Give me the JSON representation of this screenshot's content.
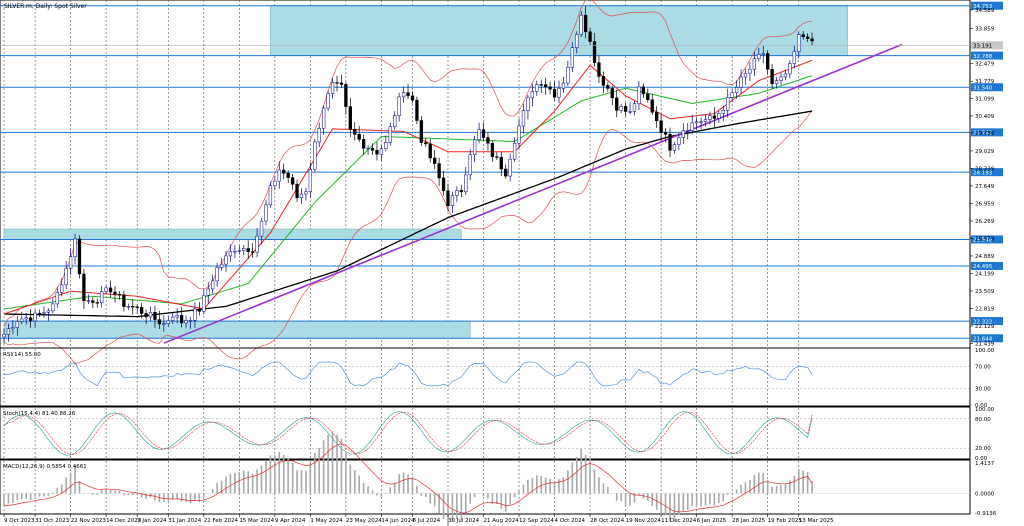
{
  "title": "SILVER.m, Daily: Spot Silver",
  "colors": {
    "bull": "#000080",
    "bear": "#000000",
    "zone": "#a9dce3",
    "hline": "#1e78d2",
    "trend": "#9b30d0",
    "ema20": "#e8231f",
    "ema50": "#22b922",
    "ema200": "#000000",
    "bands": "#e05050",
    "rsi": "#3c7fd8",
    "stoch_main": "#20a0a0",
    "stoch_signal": "#e03030",
    "macd_hist": "#a8a8a8",
    "macd_signal": "#e03030"
  },
  "price_axis": {
    "ticks": [
      "34.589",
      "33.859",
      "33.129",
      "32.479",
      "31.779",
      "31.099",
      "30.409",
      "29.739",
      "29.029",
      "28.339",
      "27.649",
      "26.959",
      "26.269",
      "25.579",
      "24.889",
      "24.199",
      "23.509",
      "22.819",
      "22.129",
      "21.439"
    ],
    "current": "33.191",
    "range": [
      21.3,
      34.9
    ]
  },
  "levels": [
    {
      "price": 34.753,
      "label": "34.753"
    },
    {
      "price": 32.788,
      "label": "32.788"
    },
    {
      "price": 31.54,
      "label": "31.540"
    },
    {
      "price": 29.762,
      "label": "29.762"
    },
    {
      "price": 28.193,
      "label": "28.193"
    },
    {
      "price": 25.54,
      "label": "25.540"
    },
    {
      "price": 24.495,
      "label": "24.495"
    },
    {
      "price": 22.322,
      "label": "22.322"
    },
    {
      "price": 21.644,
      "label": "21.644"
    }
  ],
  "zones": [
    {
      "from_index": 60,
      "to_index": 190,
      "high": 34.753,
      "low": 32.788
    },
    {
      "from_index": 0,
      "to_index": 103,
      "high": 25.95,
      "low": 25.54
    },
    {
      "from_index": 0,
      "to_index": 105,
      "high": 22.322,
      "low": 21.644
    }
  ],
  "trendline": {
    "from_index": 36,
    "from_price": 21.45,
    "to_index": 182,
    "to_price": 31.79
  },
  "x_axis": {
    "labels": [
      {
        "index": 0,
        "text": "9 Oct 2023"
      },
      {
        "index": 7,
        "text": "31 Oct 2023"
      },
      {
        "index": 15,
        "text": "22 Nov 2023"
      },
      {
        "index": 23,
        "text": "14 Dec 2023"
      },
      {
        "index": 30,
        "text": "9 Jan 2024"
      },
      {
        "index": 37,
        "text": "31 Jan 2024"
      },
      {
        "index": 45,
        "text": "22 Feb 2024"
      },
      {
        "index": 53,
        "text": "15 Mar 2024"
      },
      {
        "index": 61,
        "text": "9 Apr 2024"
      },
      {
        "index": 69,
        "text": "1 May 2024"
      },
      {
        "index": 77,
        "text": "23 May 2024"
      },
      {
        "index": 85,
        "text": "14 Jun 2024"
      },
      {
        "index": 92,
        "text": "8 Jul 2024"
      },
      {
        "index": 100,
        "text": "30 Jul 2024"
      },
      {
        "index": 108,
        "text": "21 Aug 2024"
      },
      {
        "index": 116,
        "text": "12 Sep 2024"
      },
      {
        "index": 124,
        "text": "4 Oct 2024"
      },
      {
        "index": 132,
        "text": "28 Oct 2024"
      },
      {
        "index": 140,
        "text": "19 Nov 2024"
      },
      {
        "index": 148,
        "text": "11 Dec 2024"
      },
      {
        "index": 156,
        "text": "6 Jan 2025"
      },
      {
        "index": 164,
        "text": "28 Jan 2025"
      },
      {
        "index": 172,
        "text": "19 Feb 2025"
      },
      {
        "index": 179,
        "text": "13 Mar 2025"
      }
    ]
  },
  "chart_data": {
    "type": "line",
    "description": "Daily silver price path (closing levels estimated from the candlestick chart), one point per bar.",
    "anchors": [
      [
        0,
        21.8
      ],
      [
        3,
        22.4
      ],
      [
        7,
        22.5
      ],
      [
        11,
        22.9
      ],
      [
        14,
        24.4
      ],
      [
        16,
        25.5
      ],
      [
        18,
        23.1
      ],
      [
        21,
        23.2
      ],
      [
        24,
        23.6
      ],
      [
        27,
        23.0
      ],
      [
        30,
        22.8
      ],
      [
        33,
        22.5
      ],
      [
        36,
        22.2
      ],
      [
        38,
        22.6
      ],
      [
        40,
        22.3
      ],
      [
        42,
        22.5
      ],
      [
        44,
        22.8
      ],
      [
        48,
        24.4
      ],
      [
        52,
        25.2
      ],
      [
        56,
        25.2
      ],
      [
        58,
        26.2
      ],
      [
        60,
        27.5
      ],
      [
        62,
        28.3
      ],
      [
        64,
        28.0
      ],
      [
        66,
        27.2
      ],
      [
        68,
        27.5
      ],
      [
        70,
        29.3
      ],
      [
        72,
        30.8
      ],
      [
        74,
        31.6
      ],
      [
        76,
        31.5
      ],
      [
        78,
        29.8
      ],
      [
        81,
        29.3
      ],
      [
        84,
        29.0
      ],
      [
        86,
        29.3
      ],
      [
        88,
        30.5
      ],
      [
        90,
        31.5
      ],
      [
        92,
        31.0
      ],
      [
        94,
        29.5
      ],
      [
        97,
        28.4
      ],
      [
        100,
        27.0
      ],
      [
        103,
        27.5
      ],
      [
        105,
        29.0
      ],
      [
        107,
        29.8
      ],
      [
        110,
        28.9
      ],
      [
        113,
        28.2
      ],
      [
        115,
        29.5
      ],
      [
        117,
        30.5
      ],
      [
        119,
        31.5
      ],
      [
        121,
        31.8
      ],
      [
        124,
        31.3
      ],
      [
        126,
        31.8
      ],
      [
        128,
        33.0
      ],
      [
        130,
        34.5
      ],
      [
        132,
        33.3
      ],
      [
        134,
        32.0
      ],
      [
        136,
        31.5
      ],
      [
        138,
        30.8
      ],
      [
        141,
        30.5
      ],
      [
        143,
        31.4
      ],
      [
        145,
        31.0
      ],
      [
        148,
        29.9
      ],
      [
        150,
        29.2
      ],
      [
        153,
        29.9
      ],
      [
        156,
        30.2
      ],
      [
        160,
        30.3
      ],
      [
        163,
        31.0
      ],
      [
        166,
        31.8
      ],
      [
        169,
        32.5
      ],
      [
        171,
        32.9
      ],
      [
        173,
        31.6
      ],
      [
        175,
        31.8
      ],
      [
        177,
        32.3
      ],
      [
        179,
        33.5
      ],
      [
        181,
        33.6
      ],
      [
        182,
        33.2
      ]
    ],
    "ema20_anchors": [
      [
        0,
        22.6
      ],
      [
        15,
        23.5
      ],
      [
        30,
        23.3
      ],
      [
        45,
        22.8
      ],
      [
        60,
        25.8
      ],
      [
        74,
        29.9
      ],
      [
        90,
        29.8
      ],
      [
        100,
        29.0
      ],
      [
        115,
        29.0
      ],
      [
        124,
        30.6
      ],
      [
        132,
        32.4
      ],
      [
        140,
        31.2
      ],
      [
        150,
        30.3
      ],
      [
        160,
        30.5
      ],
      [
        170,
        31.8
      ],
      [
        182,
        32.6
      ]
    ],
    "ema50_anchors": [
      [
        0,
        22.8
      ],
      [
        20,
        23.3
      ],
      [
        40,
        23.0
      ],
      [
        55,
        23.8
      ],
      [
        70,
        27.0
      ],
      [
        85,
        29.6
      ],
      [
        100,
        29.5
      ],
      [
        115,
        29.4
      ],
      [
        130,
        31.0
      ],
      [
        140,
        31.5
      ],
      [
        155,
        30.9
      ],
      [
        170,
        31.3
      ],
      [
        182,
        32.0
      ]
    ],
    "ema200_anchors": [
      [
        0,
        22.6
      ],
      [
        30,
        22.5
      ],
      [
        50,
        22.9
      ],
      [
        75,
        24.3
      ],
      [
        100,
        26.4
      ],
      [
        125,
        28.0
      ],
      [
        140,
        29.1
      ],
      [
        150,
        29.6
      ],
      [
        165,
        30.1
      ],
      [
        182,
        30.6
      ]
    ],
    "rsi": {
      "label": "RSI(14) 55.00",
      "period": 14,
      "value": 55.0,
      "levels": [
        70,
        30
      ],
      "ticks": [
        "100.00",
        "70.00",
        "30.00",
        "0.00"
      ]
    },
    "stochastic": {
      "label": "Stoch(15,4,4) 81.40 88.26",
      "main": 81.4,
      "signal": 88.26,
      "ticks": [
        "100.00",
        "80.00",
        "20.00",
        "0.00"
      ]
    },
    "macd": {
      "label": "MACD(12,26,9) 0.5854 0.4661",
      "main": 0.5854,
      "signal": 0.4661,
      "ticks": [
        "1.4137",
        "0.0000",
        "-0.9136"
      ]
    }
  }
}
